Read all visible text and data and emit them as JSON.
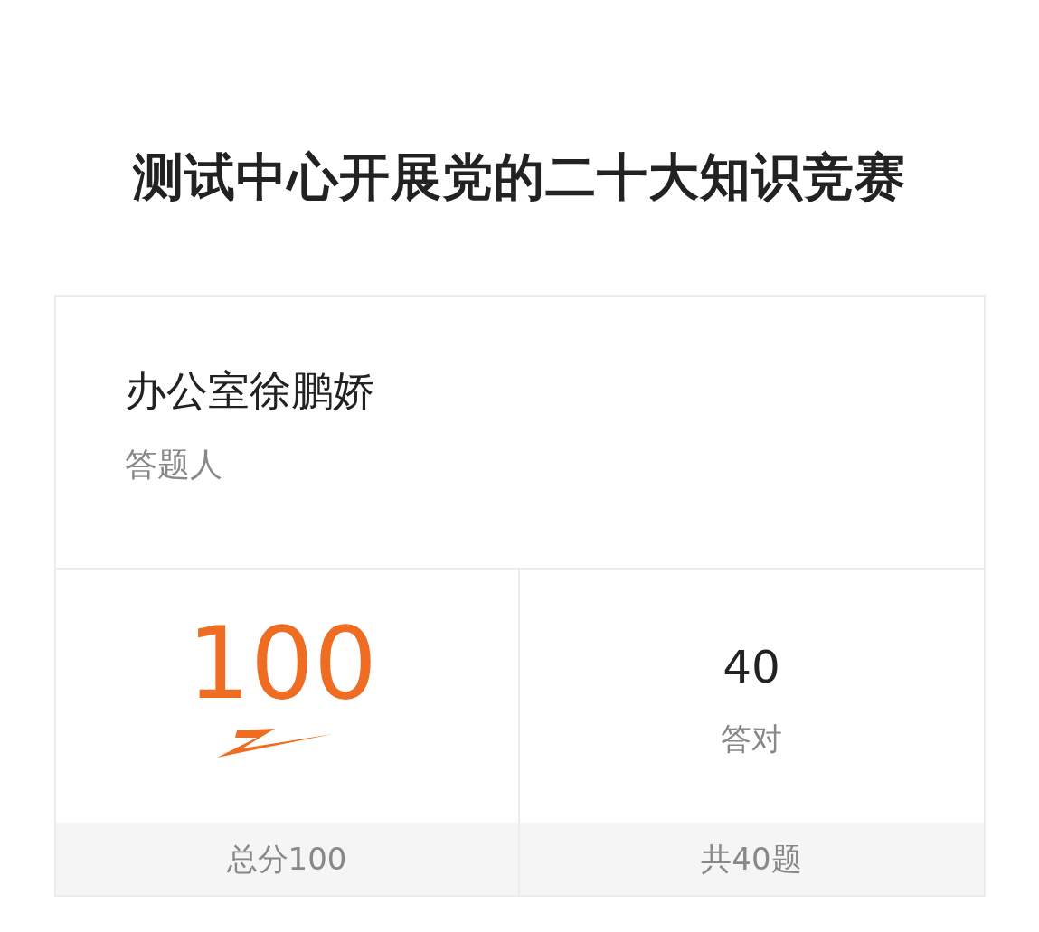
{
  "title": "测试中心开展党的二十大知识竞赛",
  "respondent": {
    "name": "办公室徐鹏娇",
    "label": "答题人"
  },
  "score": {
    "value": "100",
    "footer": "总分100"
  },
  "correct": {
    "value": "40",
    "label": "答对",
    "footer": "共40题"
  }
}
